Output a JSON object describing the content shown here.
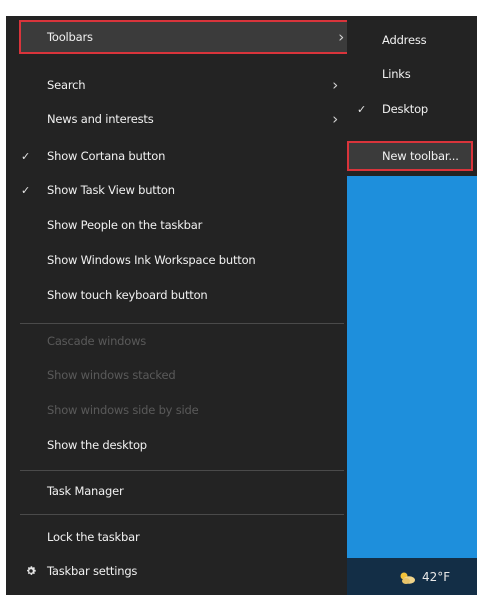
{
  "context_menu": {
    "items": [
      {
        "label": "Toolbars",
        "checked": false,
        "submenu": true,
        "enabled": true,
        "highlighted": true
      },
      {
        "label": "Search",
        "checked": false,
        "submenu": true,
        "enabled": true
      },
      {
        "label": "News and interests",
        "checked": false,
        "submenu": true,
        "enabled": true
      },
      {
        "label": "Show Cortana button",
        "checked": true,
        "submenu": false,
        "enabled": true
      },
      {
        "label": "Show Task View button",
        "checked": true,
        "submenu": false,
        "enabled": true
      },
      {
        "label": "Show People on the taskbar",
        "checked": false,
        "submenu": false,
        "enabled": true
      },
      {
        "label": "Show Windows Ink Workspace button",
        "checked": false,
        "submenu": false,
        "enabled": true
      },
      {
        "label": "Show touch keyboard button",
        "checked": false,
        "submenu": false,
        "enabled": true
      },
      {
        "label": "Cascade windows",
        "checked": false,
        "submenu": false,
        "enabled": false
      },
      {
        "label": "Show windows stacked",
        "checked": false,
        "submenu": false,
        "enabled": false
      },
      {
        "label": "Show windows side by side",
        "checked": false,
        "submenu": false,
        "enabled": false
      },
      {
        "label": "Show the desktop",
        "checked": false,
        "submenu": false,
        "enabled": true
      },
      {
        "label": "Task Manager",
        "checked": false,
        "submenu": false,
        "enabled": true
      },
      {
        "label": "Lock the taskbar",
        "checked": false,
        "submenu": false,
        "enabled": true
      },
      {
        "label": "Taskbar settings",
        "checked": false,
        "submenu": false,
        "enabled": true,
        "icon": "gear-icon"
      }
    ],
    "check_glyph": "✓",
    "chevron_glyph": "›"
  },
  "toolbars_submenu": {
    "items": [
      {
        "label": "Address",
        "checked": false
      },
      {
        "label": "Links",
        "checked": false
      },
      {
        "label": "Desktop",
        "checked": true
      },
      {
        "label": "New toolbar...",
        "checked": false,
        "highlighted": true
      }
    ]
  },
  "taskbar": {
    "weather_icon": "weather-icon",
    "temperature": "42°F"
  },
  "colors": {
    "menu_background": "#232323",
    "highlight_background": "#3b3b3b",
    "annotation_outline": "#d9343b",
    "desktop_blue": "#1e8fdc",
    "disabled_text": "#5a5a5a"
  }
}
